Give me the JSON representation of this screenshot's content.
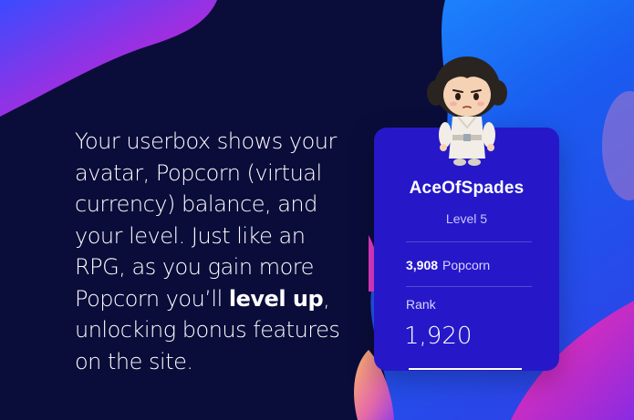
{
  "intro": {
    "text_before": "Your userbox shows your avatar, Popcorn (virtual currency) balance, and your level. Just like an RPG, as you gain more Popcorn you’ll ",
    "text_bold": "level up",
    "text_after": ", unlocking bonus features on the site."
  },
  "userbox": {
    "username": "AceOfSpades",
    "level": "Level 5",
    "popcorn_amount": "3,908",
    "popcorn_label": "Popcorn",
    "rank_label": "Rank",
    "rank_value": "1,920"
  },
  "colors": {
    "background": "#0a0d3a",
    "card": "#2618c8",
    "blob_blue": "#1466f0",
    "blob_magenta": "#c62ad6",
    "blob_orange": "#f0a060"
  },
  "icons": {
    "avatar": "chibi-character-avatar"
  }
}
